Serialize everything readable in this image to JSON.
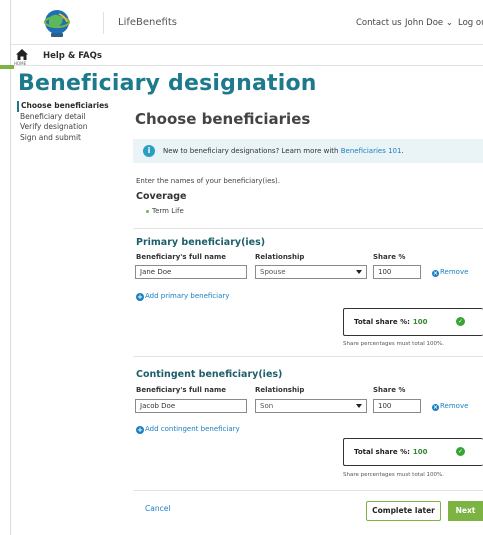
{
  "header": {
    "brand": "LifeBenefits",
    "contact_label": "Contact us",
    "user_name": "John Doe",
    "user_chevron": "⌄",
    "logout_label": "Log out",
    "logo_icon": "globe-logo-icon"
  },
  "subnav": {
    "home_icon": "home-icon",
    "home_label": "HOME",
    "help_label": "Help & FAQs"
  },
  "page": {
    "title": "Beneficiary designation"
  },
  "steps": [
    {
      "label": "Choose beneficiaries",
      "active": true
    },
    {
      "label": "Beneficiary detail",
      "active": false
    },
    {
      "label": "Verify designation",
      "active": false
    },
    {
      "label": "Sign and submit",
      "active": false
    }
  ],
  "main": {
    "section_title": "Choose beneficiaries",
    "info": {
      "icon": "info-icon",
      "text": "New to beneficiary designations? Learn more with ",
      "link": "Beneficiaries 101",
      "suffix": "."
    },
    "enter_names": "Enter the names of your beneficiary(ies).",
    "coverage_label": "Coverage",
    "coverage_item": "Term Life"
  },
  "columns": {
    "name": "Beneficiary's full name",
    "relationship": "Relationship",
    "share": "Share %"
  },
  "primary": {
    "title": "Primary beneficiary(ies)",
    "name_value": "Jane Doe",
    "relationship_value": "Spouse",
    "share_value": "100",
    "remove_label": "Remove",
    "add_label": "Add primary beneficiary",
    "total_label": "Total share %:",
    "total_value": "100",
    "note": "Share percentages must total 100%."
  },
  "contingent": {
    "title": "Contingent beneficiary(ies)",
    "name_value": "Jacob Doe",
    "relationship_value": "Son",
    "share_value": "100",
    "remove_label": "Remove",
    "add_label": "Add contingent beneficiary",
    "total_label": "Total share %:",
    "total_value": "100",
    "note": "Share percentages must total 100%."
  },
  "footer": {
    "cancel_label": "Cancel",
    "complete_later_label": "Complete later",
    "next_label": "Next"
  },
  "colors": {
    "title_teal": "#1c7a8c",
    "accent_green": "#7cb342",
    "link_blue": "#1a7fc1",
    "info_bg": "#eaf3f6"
  }
}
